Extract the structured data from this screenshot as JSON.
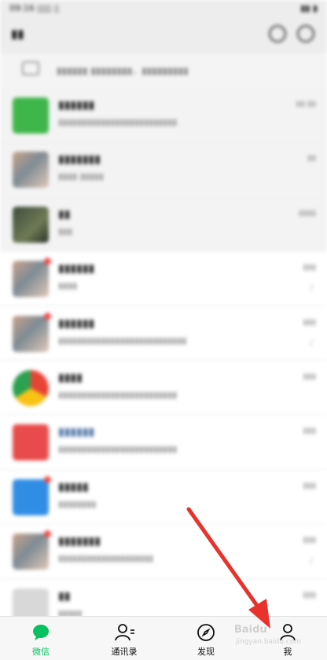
{
  "tabbar": {
    "tabs": [
      {
        "label": "微信",
        "icon": "chat-bubble-icon",
        "active": true
      },
      {
        "label": "通讯录",
        "icon": "contacts-icon",
        "active": false
      },
      {
        "label": "发现",
        "icon": "compass-icon",
        "active": false
      },
      {
        "label": "我",
        "icon": "person-icon",
        "active": false
      }
    ]
  },
  "watermark": {
    "text": "Baidu",
    "sub": "jingyan.baidu.com"
  },
  "colors": {
    "active_green": "#07c160",
    "arrow_red": "#e8322b",
    "badge_red": "#f04a4a"
  }
}
